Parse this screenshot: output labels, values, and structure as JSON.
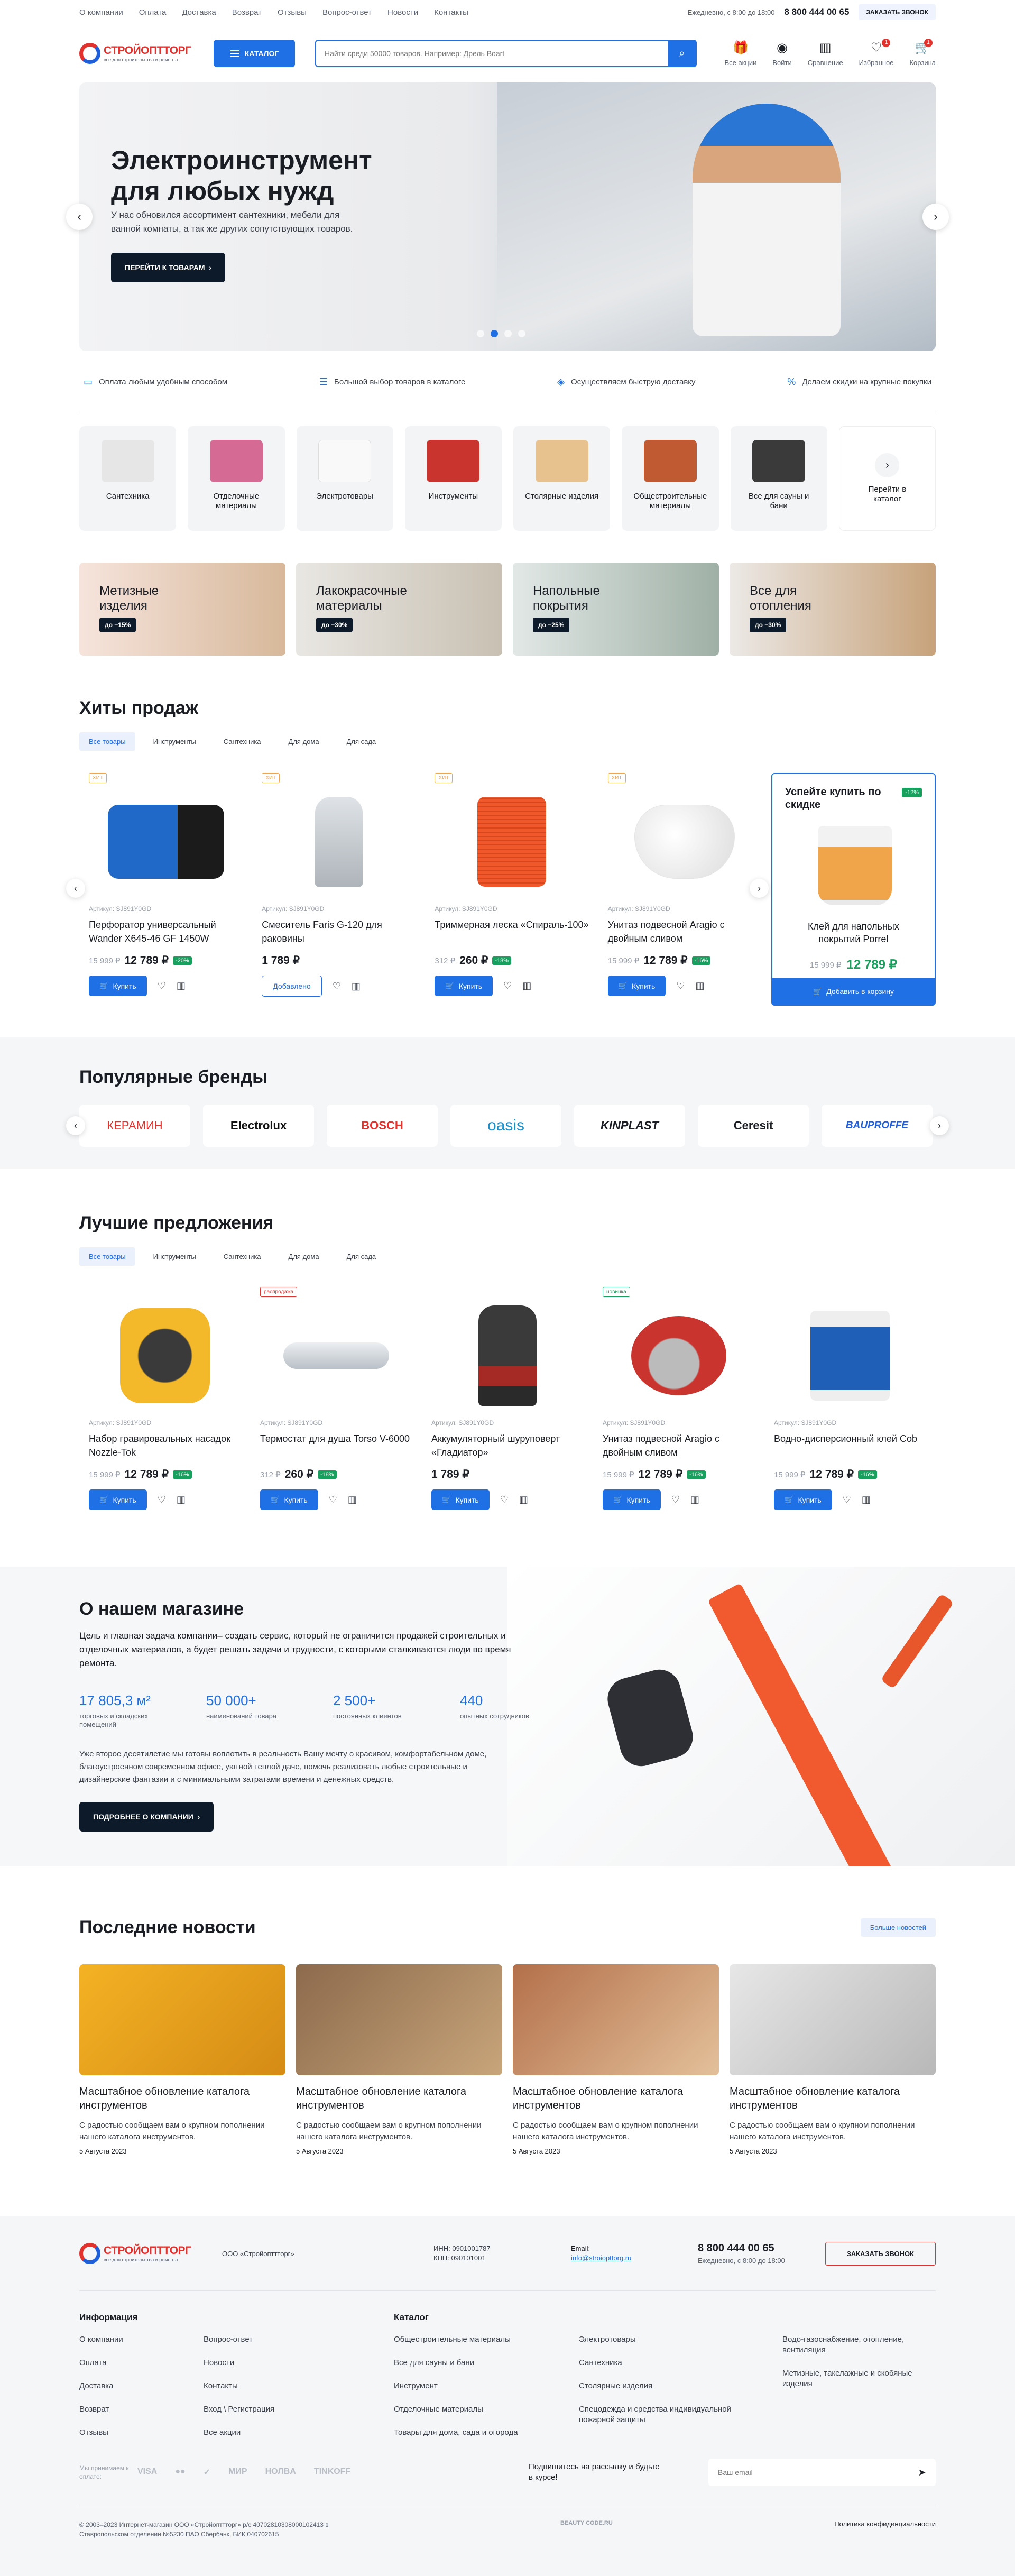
{
  "topnav": [
    "О компании",
    "Оплата",
    "Доставка",
    "Возврат",
    "Отзывы",
    "Вопрос-ответ",
    "Новости",
    "Контакты"
  ],
  "contacts": {
    "hours": "Ежедневно, с 8:00 до 18:00",
    "phone": "8 800 444 00 65",
    "callback": "ЗАКАЗАТЬ ЗВОНОК"
  },
  "logo": {
    "name": "СТРОЙОПТТОРГ",
    "tagline": "все для строительства и ремонта"
  },
  "header": {
    "catalog": "КАТАЛОГ",
    "search_placeholder": "Найти среди 50000 товаров. Например: Дрель Boart",
    "icons": [
      {
        "label": "Все акции",
        "icon": "sale-icon"
      },
      {
        "label": "Войти",
        "icon": "user-icon"
      },
      {
        "label": "Сравнение",
        "icon": "compare-icon"
      },
      {
        "label": "Избранное",
        "icon": "heart-icon",
        "badge": "1"
      },
      {
        "label": "Корзина",
        "icon": "cart-icon",
        "badge": "1"
      }
    ]
  },
  "hero": {
    "title": "Электроинструмент для любых нужд",
    "text": "У нас обновился ассортимент сантехники, мебели для ванной комнаты, а так же других сопутствующих товаров.",
    "cta": "ПЕРЕЙТИ К ТОВАРАМ",
    "slides": 4,
    "active": 1
  },
  "features": [
    "Оплата любым удобным способом",
    "Большой выбор товаров в каталоге",
    "Осуществляем быструю доставку",
    "Делаем скидки на крупные покупки"
  ],
  "categories": [
    {
      "label": "Сантехника",
      "color": "#e6e6e6"
    },
    {
      "label": "Отделочные материалы",
      "color": "#d56a95"
    },
    {
      "label": "Электротовары",
      "color": "#f1f1f1"
    },
    {
      "label": "Инструменты",
      "color": "#c9342e"
    },
    {
      "label": "Столярные изделия",
      "color": "#e8c28e"
    },
    {
      "label": "Общестроительные материалы",
      "color": "#c05a33"
    },
    {
      "label": "Все для сауны и бани",
      "color": "#3a3a3a"
    },
    {
      "label": "Перейти в каталог",
      "more": true
    }
  ],
  "promos": [
    {
      "title": "Метизные изделия",
      "discount": "до −15%",
      "bg": "linear-gradient(90deg,#f6e4dc,#d7b89a)"
    },
    {
      "title": "Лакокрасочные материалы",
      "discount": "до −30%",
      "bg": "linear-gradient(90deg,#e9e7e3,#c8c0b2)"
    },
    {
      "title": "Напольные покрытия",
      "discount": "до −25%",
      "bg": "linear-gradient(90deg,#e2e8e6,#9fb0a6)"
    },
    {
      "title": "Все для отопления",
      "discount": "до −30%",
      "bg": "linear-gradient(90deg,#ece9e6,#c7a27a)"
    }
  ],
  "hits": {
    "title": "Хиты продаж",
    "tabs": [
      "Все товары",
      "Инструменты",
      "Сантехника",
      "Для дома",
      "Для сада"
    ],
    "products": [
      {
        "badge": "ХИТ",
        "article": "Артикул: SJ891Y0GD",
        "name": "Перфоратор универсальный Wander X645-46 GF 1450W",
        "old": "15 999 ₽",
        "price": "12 789 ₽",
        "disc": "-20%",
        "buy": "Купить",
        "color": "#2069c9"
      },
      {
        "badge": "ХИТ",
        "article": "Артикул: SJ891Y0GD",
        "name": "Смеситель Faris G-120 для раковины",
        "old": "",
        "price": "1 789 ₽",
        "disc": "",
        "buy": "Добавлено",
        "added": true,
        "color": "#c9ced4"
      },
      {
        "badge": "ХИТ",
        "article": "Артикул: SJ891Y0GD",
        "name": "Триммерная леска «Спираль-100»",
        "old": "312 ₽",
        "price": "260 ₽",
        "disc": "-18%",
        "buy": "Купить",
        "color": "#f0582b"
      },
      {
        "badge": "ХИТ",
        "article": "Артикул: SJ891Y0GD",
        "name": "Унитаз подвесной Aragio с двойным сливом",
        "old": "15 999 ₽",
        "price": "12 789 ₽",
        "disc": "-16%",
        "buy": "Купить",
        "color": "#eeeeee"
      }
    ],
    "promo": {
      "title": "Успейте купить по скидке",
      "pct": "-12%",
      "name": "Клей для напольных покрытий Porrel",
      "old": "15 999 ₽",
      "price": "12 789 ₽",
      "buy": "Добавить в корзину"
    }
  },
  "brands": {
    "title": "Популярные бренды",
    "items": [
      "КЕРАМИН",
      "Electrolux",
      "BOSCH",
      "oasis",
      "KINPLAST",
      "Ceresit",
      "BAUPROFFE"
    ]
  },
  "best": {
    "title": "Лучшие предложения",
    "tabs": [
      "Все товары",
      "Инструменты",
      "Сантехника",
      "Для дома",
      "Для сада"
    ],
    "products": [
      {
        "badge": "",
        "article": "Артикул: SJ891Y0GD",
        "name": "Набор гравировальных насадок Nozzle-Tok",
        "old": "15 999 ₽",
        "price": "12 789 ₽",
        "disc": "-16%",
        "buy": "Купить",
        "color": "#f3b92a"
      },
      {
        "badge": "распродажа",
        "article": "Артикул: SJ891Y0GD",
        "name": "Термостат для душа Torso V-6000",
        "old": "312 ₽",
        "price": "260 ₽",
        "disc": "-18%",
        "buy": "Купить",
        "color": "#c9ced4"
      },
      {
        "badge": "",
        "article": "Артикул: SJ891Y0GD",
        "name": "Аккумуляторный шуруповерт «Гладиатор»",
        "old": "",
        "price": "1 789 ₽",
        "disc": "",
        "buy": "Купить",
        "color": "#3a3a3a"
      },
      {
        "badge": "новинка",
        "article": "Артикул: SJ891Y0GD",
        "name": "Унитаз подвесной Aragio с двойным сливом",
        "old": "15 999 ₽",
        "price": "12 789 ₽",
        "disc": "-16%",
        "buy": "Купить",
        "color": "#c9342e"
      },
      {
        "badge": "",
        "article": "Артикул: SJ891Y0GD",
        "name": "Водно-дисперсионный клей Cob",
        "old": "15 999 ₽",
        "price": "12 789 ₽",
        "disc": "-16%",
        "buy": "Купить",
        "color": "#1f5fb8"
      }
    ]
  },
  "about": {
    "title": "О нашем магазине",
    "lead": "Цель и главная задача компании– создать сервис, который не ограничится продажей строительных и отделочных материалов, а будет решать задачи и трудности, с которыми сталкиваются люди во время ремонта.",
    "stats": [
      {
        "v": "17 805,3 м²",
        "l": "торговых и складских помещений"
      },
      {
        "v": "50 000+",
        "l": "наименований товара"
      },
      {
        "v": "2 500+",
        "l": "постоянных клиентов"
      },
      {
        "v": "440",
        "l": "опытных сотрудников"
      }
    ],
    "text": "Уже второе десятилетие мы готовы воплотить в реальность Вашу мечту о красивом, комфортабельном доме, благоустроенном современном офисе, уютной теплой даче, помочь реализовать любые строительные и дизайнерские фантазии и с минимальными затратами времени и денежных средств.",
    "cta": "ПОДРОБНЕЕ О КОМПАНИИ"
  },
  "news": {
    "title": "Последние новости",
    "all": "Больше новостей",
    "items": [
      {
        "title": "Масштабное обновление каталога инструментов",
        "text": "С радостью сообщаем вам о крупном пополнении нашего каталога инструментов.",
        "date": "5 Августа 2023",
        "bg": "linear-gradient(135deg,#f4b224,#d58b15)"
      },
      {
        "title": "Масштабное обновление каталога инструментов",
        "text": "С радостью сообщаем вам о крупном пополнении нашего каталога инструментов.",
        "date": "5 Августа 2023",
        "bg": "linear-gradient(135deg,#8c6a4c,#c8a57a)"
      },
      {
        "title": "Масштабное обновление каталога инструментов",
        "text": "С радостью сообщаем вам о крупном пополнении нашего каталога инструментов.",
        "date": "5 Августа 2023",
        "bg": "linear-gradient(135deg,#b3704a,#e3c09a)"
      },
      {
        "title": "Масштабное обновление каталога инструментов",
        "text": "С радостью сообщаем вам о крупном пополнении нашего каталога инструментов.",
        "date": "5 Августа 2023",
        "bg": "linear-gradient(135deg,#e7e7e7,#b8b8b8)"
      }
    ]
  },
  "footer": {
    "company": "ООО «Стройопттторг»",
    "inn": "ИНН: 0901001787",
    "kpp": "КПП: 090101001",
    "email_label": "Email:",
    "email": "info@stroiopttorg.ru",
    "phone": "8 800 444 00 65",
    "hours": "Ежедневно, с 8:00 до 18:00",
    "callback": "ЗАКАЗАТЬ ЗВОНОК",
    "info_title": "Информация",
    "info1": [
      "О компании",
      "Оплата",
      "Доставка",
      "Возврат",
      "Отзывы"
    ],
    "info2": [
      "Вопрос-ответ",
      "Новости",
      "Контакты",
      "Вход \\ Регистрация",
      "Все акции"
    ],
    "catalog_title": "Каталог",
    "cat1": [
      "Общестроительные материалы",
      "Все для сауны и бани",
      "Инструмент",
      "Отделочные материалы",
      "Товары для дома, сада и огорода"
    ],
    "cat2": [
      "Электротовары",
      "Сантехника",
      "Столярные изделия",
      "Спецодежда и средства индивидуальной пожарной защиты"
    ],
    "cat3": [
      "Водо-газоснабжение, отопление, вентиляция",
      "Метизные, такелажные и скобяные изделия"
    ],
    "pay_label": "Мы принимаем к оплате:",
    "pay": [
      "VISA",
      "●●",
      "✓",
      "МИР",
      "HOЛBA",
      "TINKOFF"
    ],
    "sub_label": "Подпишитесь на рассылку и будьте в курсе!",
    "sub_placeholder": "Ваш email",
    "copy": "© 2003–2023 Интернет-магазин ООО «Стройопттторг» р/с 40702810308000102413 в Ставропольском отделении №5230 ПАО Сбербанк, БИК 040702615",
    "policy": "Политика конфиденциальности",
    "dev": "BEAUTY CODE.RU"
  }
}
